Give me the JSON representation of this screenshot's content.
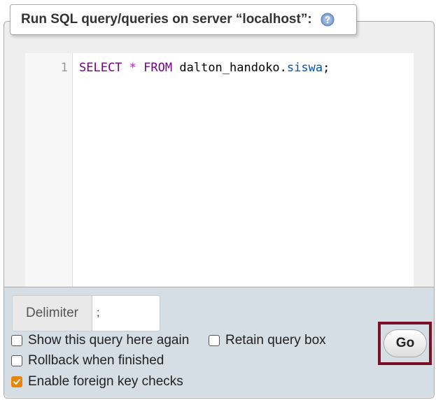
{
  "fieldset": {
    "title": "Run SQL query/queries on server “localhost”:",
    "help_icon": "help-icon"
  },
  "editor": {
    "line_number": "1",
    "tokens": {
      "select": "SELECT",
      "star": "*",
      "from": "FROM",
      "db": "dalton_handoko",
      "dot": ".",
      "table": "siswa",
      "semicolon": ";"
    }
  },
  "delimiter": {
    "label": "Delimiter",
    "value": ";"
  },
  "options": {
    "show_query": {
      "label": "Show this query here again",
      "checked": false
    },
    "retain_box": {
      "label": "Retain query box",
      "checked": false
    },
    "rollback": {
      "label": "Rollback when finished",
      "checked": false
    },
    "foreign_keys": {
      "label": "Enable foreign key checks",
      "checked": true
    }
  },
  "go_button": {
    "label": "Go"
  },
  "colors": {
    "keyword": "#770088",
    "operator": "#dd00dd",
    "table": "#0055aa",
    "checkbox_checked": "#e8860c",
    "highlight_frame": "#7a1027"
  }
}
